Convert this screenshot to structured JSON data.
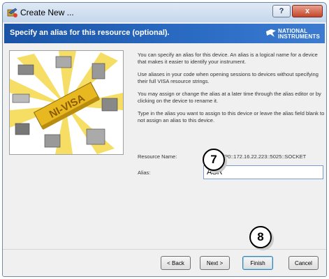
{
  "window": {
    "title": "Create New ...",
    "help_button": "?",
    "close_button": "x"
  },
  "header": {
    "text": "Specify an alias for this resource (optional).",
    "logo_line1": "NATIONAL",
    "logo_line2": "INSTRUMENTS"
  },
  "art": {
    "label": "NI-VISA"
  },
  "content": {
    "p1": "You can specify an alias for this device. An alias is a logical name for a device that makes it easier to identify your instrument.",
    "p2": "Use aliases in your code when opening sessions to devices without specifying their full VISA resource strings.",
    "p3": "You may assign or change the alias at a later time through the alias editor or by clicking on the device to rename it.",
    "p4": "Type in the alias you want to assign to this device or leave the alias field blank to not assign an alias to this device."
  },
  "resource": {
    "label": "Resource Name:",
    "value": "TCPIP0::172.16.22.223::5025::SOCKET"
  },
  "alias": {
    "label": "Alias:",
    "value": "ASR"
  },
  "buttons": {
    "back": "< Back",
    "next": "Next >",
    "finish": "Finish",
    "cancel": "Cancel"
  },
  "callouts": {
    "step7": "7",
    "step8": "8"
  }
}
